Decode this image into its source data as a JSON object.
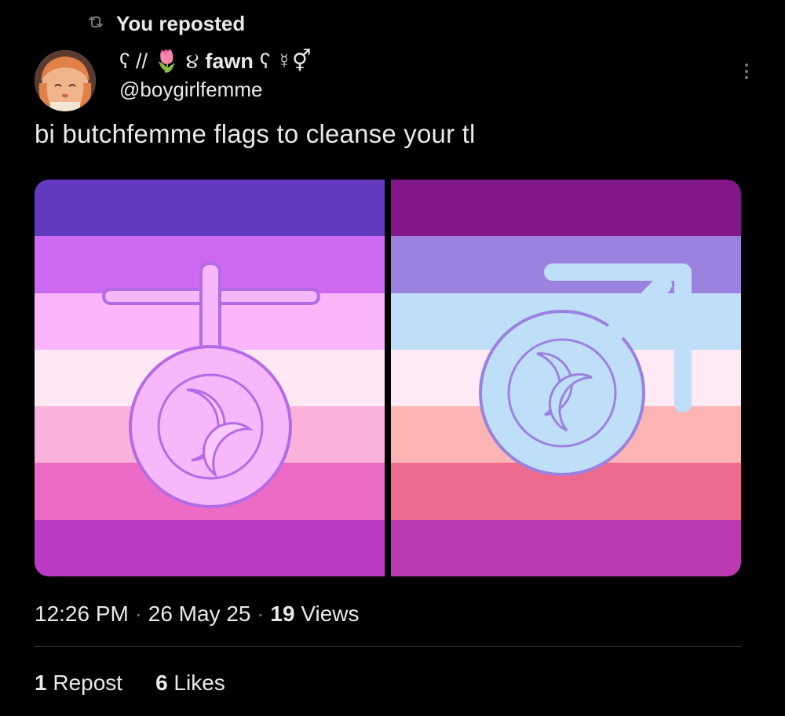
{
  "repost": {
    "label": "You reposted",
    "icon": "repost-icon"
  },
  "author": {
    "display_name_prefix": "ʕ // 🌷 ૪",
    "display_name": "fawn",
    "display_name_suffix": "ʕ ☿⚥",
    "handle": "@boygirlfemme",
    "avatar": "avatar-icon"
  },
  "tweet": {
    "text": "bi butchfemme flags to cleanse your tl"
  },
  "media": {
    "left_flag": {
      "stripes": [
        "#623abf",
        "#cd68f0",
        "#fab5fb",
        "#fee8f4",
        "#fab2dc",
        "#ec6bc6",
        "#bc3ac4"
      ],
      "symbol_fill": "#f6b7fb",
      "symbol_stroke": "#b66be6",
      "moon_fill": "#f9c9fb"
    },
    "right_flag": {
      "stripes": [
        "#82178a",
        "#9b82e0",
        "#bfdef8",
        "#fdeaf4",
        "#fdb4b4",
        "#ec6b8d",
        "#bb3ab2"
      ],
      "symbol_fill": "#bfdef8",
      "symbol_stroke": "#9b82e0",
      "moon_fill": "#bfdef8"
    }
  },
  "meta": {
    "time": "12:26 PM",
    "separator": " · ",
    "date": "26 May 25",
    "views_count": "19",
    "views_label": " Views"
  },
  "stats": {
    "reposts_count": "1",
    "reposts_label": " Repost",
    "likes_count": "6",
    "likes_label": " Likes"
  }
}
